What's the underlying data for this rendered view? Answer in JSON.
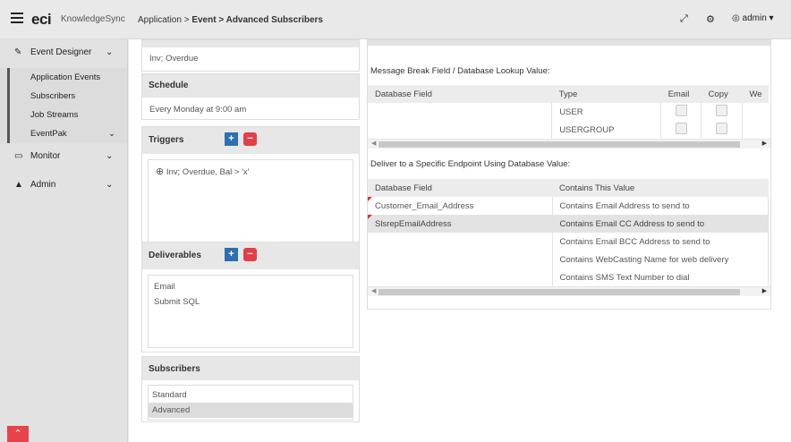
{
  "topbar": {
    "brand": "eci",
    "brand_sub": "KnowledgeSync",
    "crumb_prefix": "Application > ",
    "crumb_event": "Event",
    "crumb_sep": " > ",
    "crumb_current": "Advanced Subscribers",
    "user": "admin"
  },
  "sidebar": {
    "groups": [
      {
        "label": "Event Designer",
        "icon": "edit-icon"
      },
      {
        "label": "Monitor",
        "icon": "monitor-icon"
      },
      {
        "label": "Admin",
        "icon": "user-icon"
      }
    ],
    "event_designer_items": [
      "Application Events",
      "Subscribers",
      "Job Streams",
      "EventPak"
    ]
  },
  "event_panel": {
    "value": "Inv; Overdue"
  },
  "schedule": {
    "title": "Schedule",
    "value": "Every Monday at 9:00 am"
  },
  "triggers": {
    "title": "Triggers",
    "items": [
      "Inv; Overdue, Bal > 'x'"
    ]
  },
  "deliverables": {
    "title": "Deliverables",
    "items": [
      "Email",
      "Submit SQL"
    ]
  },
  "subscribers": {
    "title": "Subscribers",
    "items": [
      "Standard",
      "Advanced"
    ],
    "selected": "Advanced"
  },
  "message_break": {
    "title": "Message Break Field / Database Lookup Value:",
    "columns": [
      "Database Field",
      "Type",
      "Email",
      "Copy",
      "We"
    ],
    "rows": [
      {
        "field": "",
        "type": "USER",
        "email": false,
        "copy": false
      },
      {
        "field": "",
        "type": "USERGROUP",
        "email": false,
        "copy": false
      }
    ]
  },
  "endpoint": {
    "title": "Deliver to a Specific Endpoint Using Database Value:",
    "columns": [
      "Database Field",
      "Contains This Value"
    ],
    "rows": [
      {
        "field": "Customer_Email_Address",
        "value": "Contains Email Address to send to"
      },
      {
        "field": "SlsrepEmailAddress",
        "value": "Contains Email CC Address to send to"
      },
      {
        "field": "",
        "value": "Contains Email BCC Address to send to"
      },
      {
        "field": "",
        "value": "Contains WebCasting Name for web delivery"
      },
      {
        "field": "",
        "value": "Contains SMS Text Number to dial"
      }
    ]
  }
}
